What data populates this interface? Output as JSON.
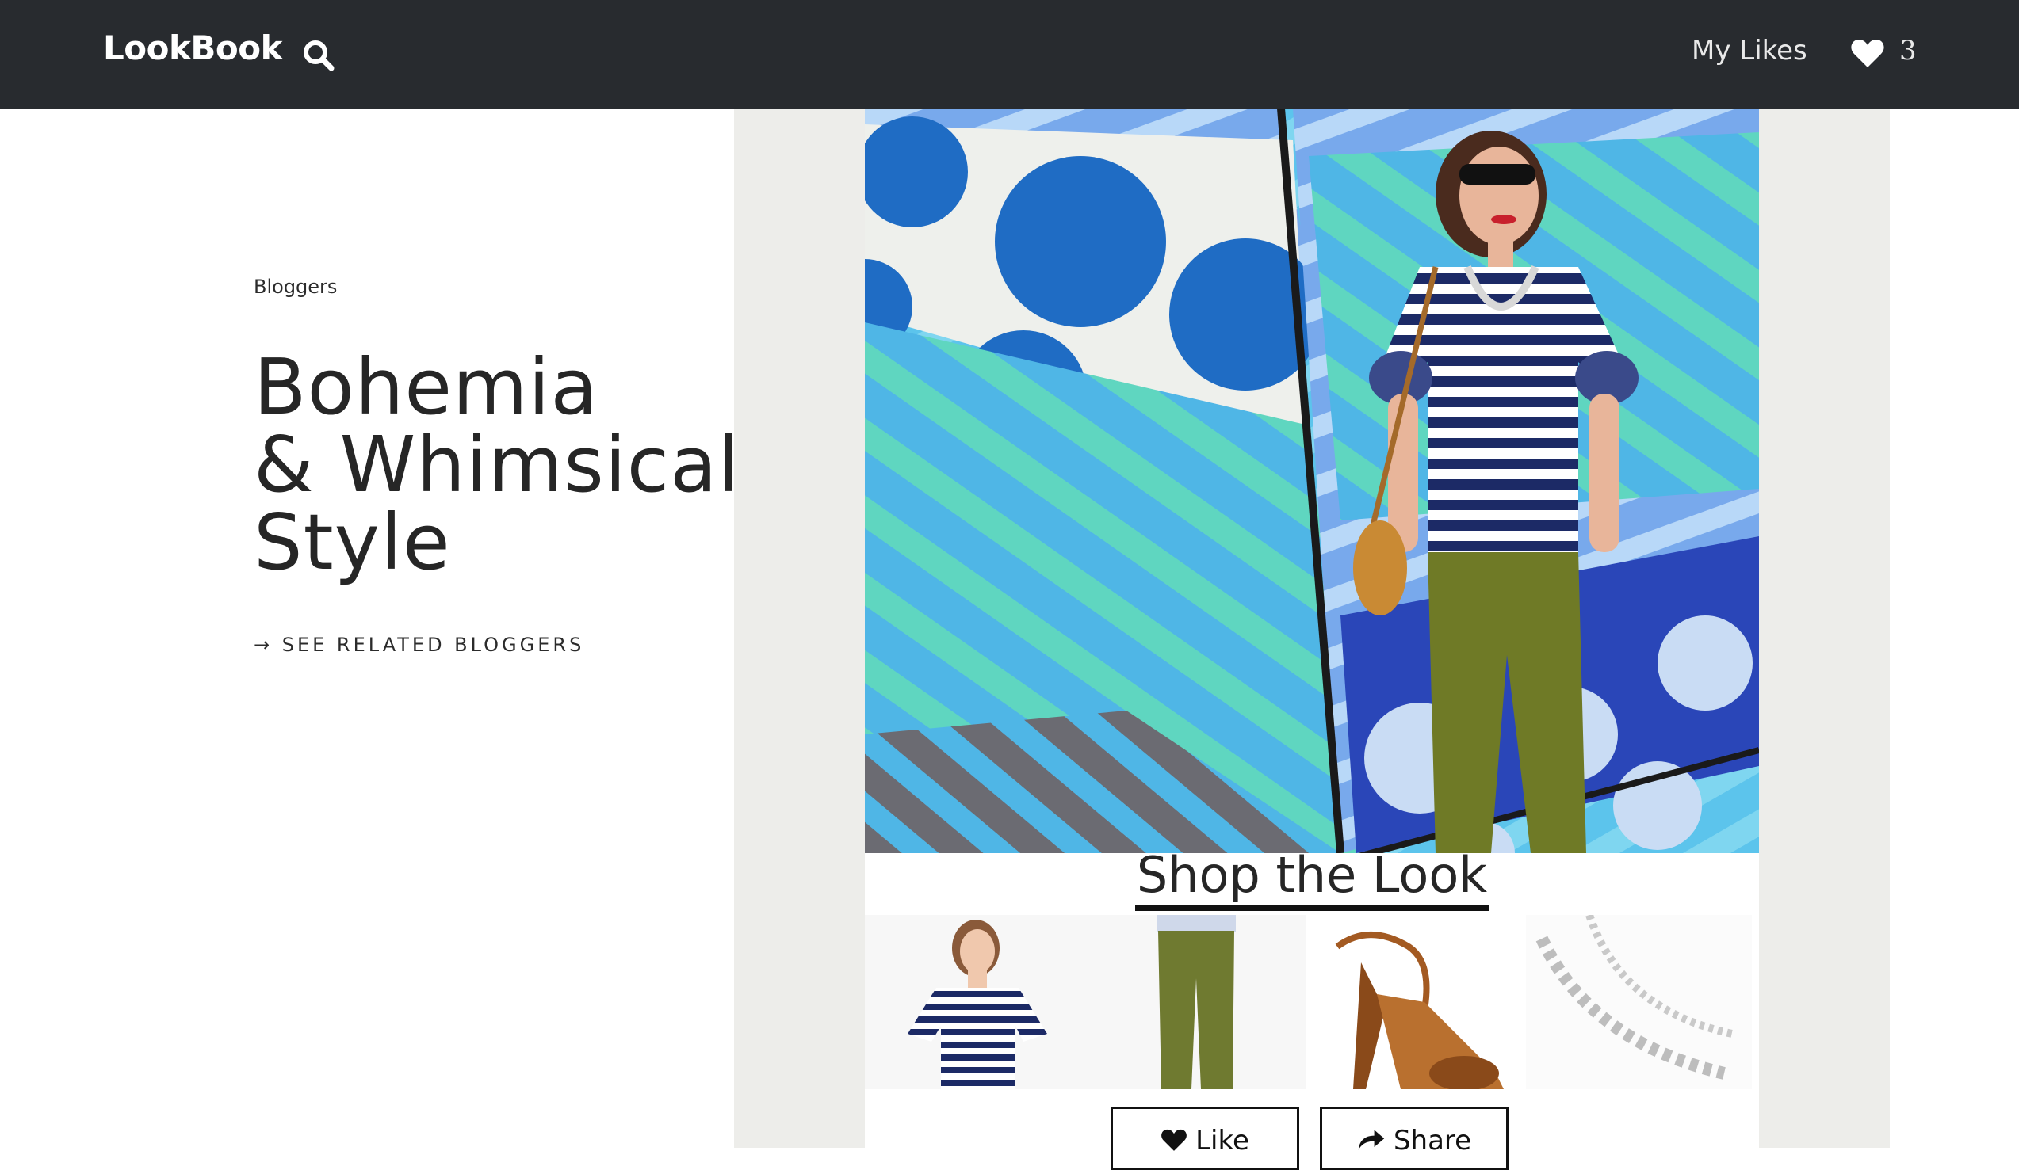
{
  "header": {
    "brand": "LookBook",
    "my_likes_label": "My Likes",
    "likes_count": "3"
  },
  "article": {
    "category": "Bloggers",
    "title_lines": [
      "Bohemia",
      "& Whimsical",
      "Style"
    ],
    "related_link": "→ SEE RELATED BLOGGERS"
  },
  "shop": {
    "heading": "Shop the Look",
    "items": [
      {
        "icon": "striped-ruffle-top-photo"
      },
      {
        "icon": "olive-cargo-pants-photo"
      },
      {
        "icon": "tan-lace-up-sandal-photo"
      },
      {
        "icon": "statement-necklace-photo"
      }
    ],
    "like_label": "Like",
    "share_label": "Share"
  },
  "colors": {
    "topbar": "#282b2f",
    "panel": "#ededea",
    "accent_blue": "#1f6cc4",
    "sky_blue": "#5cc4ec",
    "mint": "#5fd6c0"
  }
}
